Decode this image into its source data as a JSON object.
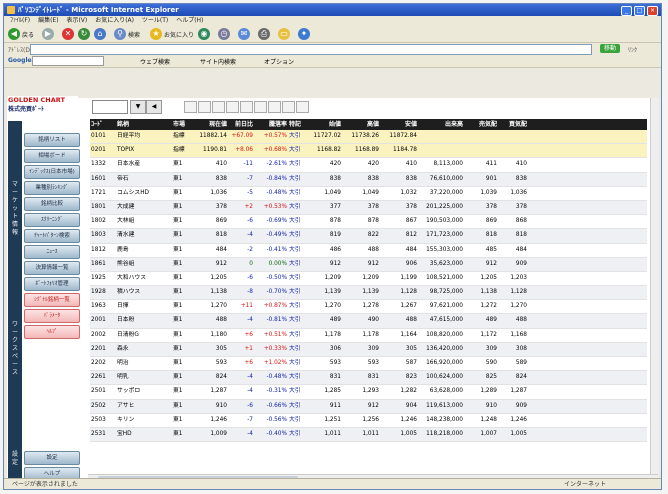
{
  "window": {
    "title": "ﾊﾟｿｺﾝﾃﾞｲﾄﾚｰﾄﾞ - Microsoft Internet Explorer",
    "buttons": [
      "_",
      "□",
      "×"
    ]
  },
  "menu": [
    "ﾌｧｲﾙ(F)",
    "編集(E)",
    "表示(V)",
    "お気に入り(A)",
    "ツール(T)",
    "ヘルプ(H)"
  ],
  "toolbar": {
    "back_label": "戻る",
    "search_label": "検索",
    "favorites_label": "お気に入り"
  },
  "address": {
    "label": "ｱﾄﾞﾚｽ(D)",
    "value": "",
    "go_label": "移動",
    "links_label": "ﾘﾝｸ"
  },
  "linkbar": {
    "google": "Google",
    "web_search": "ウェブ検索",
    "site_search": "サイト内検索",
    "options": "オプション"
  },
  "logo": {
    "line1": "GOLDEN CHART",
    "line2": "株式売買ﾎﾟｰﾄ"
  },
  "sidebar": {
    "strip_top": "マーケット情報",
    "strip_mid": "ワークスペース",
    "strip_bottom": "設定",
    "buttons": [
      {
        "label": "銘柄リスト",
        "pink": false
      },
      {
        "label": "相場ボード",
        "pink": false
      },
      {
        "label": "ｲﾝﾃﾞｯｸｽ(日本市場)",
        "pink": false
      },
      {
        "label": "業種別ﾗﾝｷﾝｸﾞ",
        "pink": false
      },
      {
        "label": "銘柄比較",
        "pink": false
      },
      {
        "label": "ｽｸﾘｰﾆﾝｸﾞ",
        "pink": false
      },
      {
        "label": "ﾁｬｰﾄﾊﾟﾀｰﾝ検索",
        "pink": false
      },
      {
        "label": "ﾆｭｰｽ",
        "pink": false
      },
      {
        "label": "決算情報一覧",
        "pink": false
      },
      {
        "label": "ﾎﾟｰﾄﾌｫﾘｵ管理",
        "pink": false
      },
      {
        "label": "ｼｸﾞﾅﾙ銘柄一覧",
        "pink": true
      },
      {
        "label": "ﾊﾟﾗﾒｰﾀ",
        "pink": true
      },
      {
        "label": "ﾍﾙﾌﾟ",
        "pink": true
      },
      {
        "label": "設定",
        "pink": false
      },
      {
        "label": "ヘルプ",
        "pink": false
      }
    ]
  },
  "grid": {
    "headers": [
      "ｺｰﾄﾞ",
      "銘柄",
      "市場",
      "現在値",
      "前日比",
      "騰落率",
      "特記",
      "始値",
      "高値",
      "安値",
      "出来高",
      "売気配",
      "買気配"
    ],
    "rows": [
      [
        "0101",
        "日経平均",
        "指標",
        "11882.14",
        "+67.09",
        "+0.57%",
        "大引",
        "11727.02",
        "11738.26",
        "11872.84",
        "",
        "",
        ""
      ],
      [
        "0201",
        "TOPIX",
        "指標",
        "1190.81",
        "+8.06",
        "+0.68%",
        "大引",
        "1168.82",
        "1168.89",
        "1184.78",
        "",
        "",
        ""
      ],
      [
        "1332",
        "日本水産",
        "東1",
        "410",
        "-11",
        "-2.61%",
        "大引",
        "420",
        "420",
        "410",
        "8,113,000",
        "411",
        "410"
      ],
      [
        "1601",
        "帝石",
        "東1",
        "838",
        "-7",
        "-0.84%",
        "大引",
        "838",
        "838",
        "838",
        "76,610,000",
        "901",
        "838"
      ],
      [
        "1721",
        "コムシスHD",
        "東1",
        "1,036",
        "-5",
        "-0.48%",
        "大引",
        "1,049",
        "1,049",
        "1,032",
        "37,220,000",
        "1,039",
        "1,036"
      ],
      [
        "1801",
        "大成建",
        "東1",
        "378",
        "+2",
        "+0.53%",
        "大引",
        "377",
        "378",
        "378",
        "201,225,000",
        "378",
        "378"
      ],
      [
        "1802",
        "大林組",
        "東1",
        "869",
        "-6",
        "-0.69%",
        "大引",
        "878",
        "878",
        "867",
        "190,503,000",
        "869",
        "868"
      ],
      [
        "1803",
        "清水建",
        "東1",
        "818",
        "-4",
        "-0.49%",
        "大引",
        "819",
        "822",
        "812",
        "171,723,000",
        "818",
        "818"
      ],
      [
        "1812",
        "鹿島",
        "東1",
        "484",
        "-2",
        "-0.41%",
        "大引",
        "486",
        "488",
        "484",
        "155,303,000",
        "485",
        "484"
      ],
      [
        "1861",
        "熊谷組",
        "東1",
        "912",
        "0",
        "0.00%",
        "大引",
        "912",
        "912",
        "906",
        "35,623,000",
        "912",
        "909"
      ],
      [
        "1925",
        "大和ハウス",
        "東1",
        "1,205",
        "-6",
        "-0.50%",
        "大引",
        "1,209",
        "1,209",
        "1,199",
        "108,521,000",
        "1,205",
        "1,203"
      ],
      [
        "1928",
        "積ハウス",
        "東1",
        "1,138",
        "-8",
        "-0.70%",
        "大引",
        "1,139",
        "1,139",
        "1,128",
        "98,725,000",
        "1,138",
        "1,128"
      ],
      [
        "1963",
        "日揮",
        "東1",
        "1,270",
        "+11",
        "+0.87%",
        "大引",
        "1,270",
        "1,278",
        "1,267",
        "97,621,000",
        "1,272",
        "1,270"
      ],
      [
        "2001",
        "日本粉",
        "東1",
        "488",
        "-4",
        "-0.81%",
        "大引",
        "489",
        "490",
        "488",
        "47,615,000",
        "489",
        "488"
      ],
      [
        "2002",
        "日清粉G",
        "東1",
        "1,180",
        "+6",
        "+0.51%",
        "大引",
        "1,178",
        "1,178",
        "1,164",
        "108,820,000",
        "1,172",
        "1,168"
      ],
      [
        "2201",
        "森永",
        "東1",
        "305",
        "+1",
        "+0.33%",
        "大引",
        "306",
        "309",
        "305",
        "136,420,000",
        "309",
        "308"
      ],
      [
        "2202",
        "明治",
        "東1",
        "593",
        "+6",
        "+1.02%",
        "大引",
        "593",
        "593",
        "587",
        "166,920,000",
        "590",
        "589"
      ],
      [
        "2261",
        "明乳",
        "東1",
        "824",
        "-4",
        "-0.48%",
        "大引",
        "831",
        "831",
        "823",
        "100,624,000",
        "825",
        "824"
      ],
      [
        "2501",
        "サッポロ",
        "東1",
        "1,287",
        "-4",
        "-0.31%",
        "大引",
        "1,285",
        "1,293",
        "1,282",
        "63,628,000",
        "1,289",
        "1,287"
      ],
      [
        "2502",
        "アサヒ",
        "東1",
        "910",
        "-6",
        "-0.66%",
        "大引",
        "911",
        "912",
        "904",
        "119,613,000",
        "910",
        "909"
      ],
      [
        "2503",
        "キリン",
        "東1",
        "1,246",
        "-7",
        "-0.56%",
        "大引",
        "1,251",
        "1,256",
        "1,246",
        "148,238,000",
        "1,248",
        "1,246"
      ],
      [
        "2531",
        "宝HD",
        "東1",
        "1,009",
        "-4",
        "-0.40%",
        "大引",
        "1,011",
        "1,011",
        "1,005",
        "118,218,000",
        "1,007",
        "1,005"
      ]
    ]
  },
  "status": {
    "text": "ページが表示されました",
    "zone": "インターネット"
  },
  "colors": {
    "grid_header": "#1e1e1e",
    "highlight_row": "#fbf3bf",
    "up": "#dd1111",
    "down": "#1122aa",
    "sidebar_strip": "#1f3a55"
  }
}
